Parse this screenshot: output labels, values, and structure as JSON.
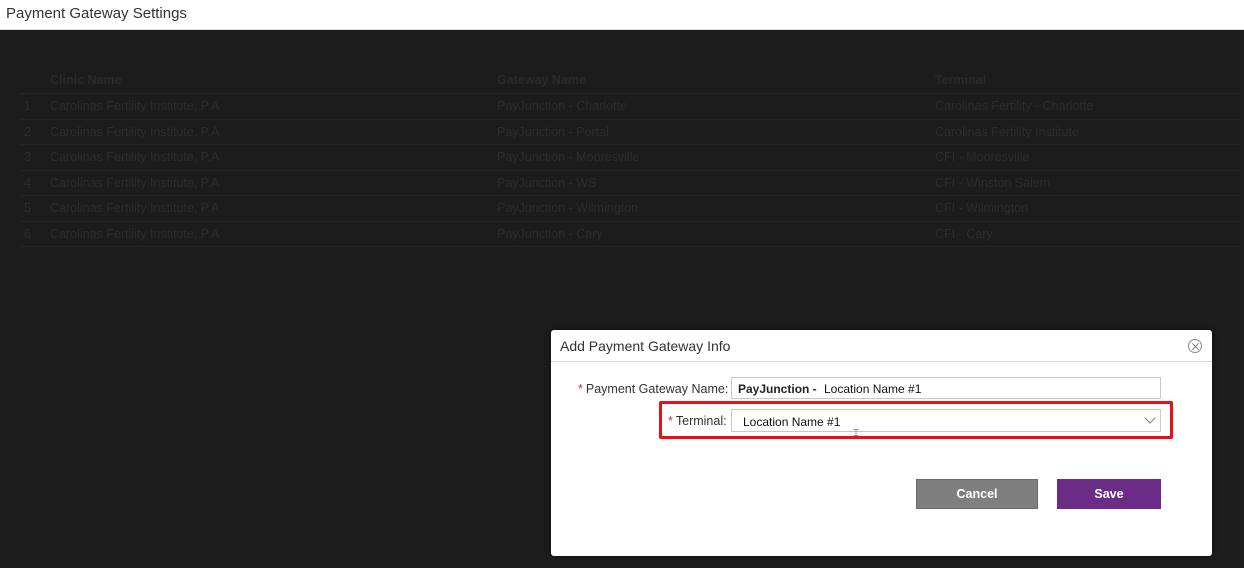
{
  "header": {
    "title": "Payment Gateway Settings"
  },
  "table": {
    "columns": [
      "Clinic Name",
      "Gateway Name",
      "Terminal"
    ],
    "rows": [
      {
        "index": "1",
        "clinic": "Carolinas Fertility Institute, P.A",
        "gateway": "PayJunction - Charlotte",
        "terminal": "Carolinas Fertility - Charlotte"
      },
      {
        "index": "2",
        "clinic": "Carolinas Fertility Institute, P.A",
        "gateway": "PayJunction - Portal",
        "terminal": "Carolinas Fertility Institute"
      },
      {
        "index": "3",
        "clinic": "Carolinas Fertility Institute, P.A",
        "gateway": "PayJunction - Mooresville",
        "terminal": "CFI - Mooresville"
      },
      {
        "index": "4",
        "clinic": "Carolinas Fertility Institute, P.A",
        "gateway": "PayJunction - WS",
        "terminal": "CFI - Winston Salem"
      },
      {
        "index": "5",
        "clinic": "Carolinas Fertility Institute, P.A",
        "gateway": "PayJunction - Wilmington",
        "terminal": "CFI - Wilmington"
      },
      {
        "index": "6",
        "clinic": "Carolinas Fertility Institute, P.A",
        "gateway": "PayJunction - Cary",
        "terminal": "CFI - Cary"
      }
    ]
  },
  "modal": {
    "title": "Add Payment Gateway Info",
    "gateway_label": "Payment Gateway Name:",
    "gateway_prefix": "PayJunction -",
    "gateway_value": "Location Name #1",
    "terminal_label": "Terminal:",
    "terminal_value": "Location Name #1",
    "required_mark": "*",
    "cancel_label": "Cancel",
    "save_label": "Save"
  },
  "colors": {
    "save_button": "#6a2c86",
    "cancel_button": "#7f7f7f",
    "highlight": "#e5121a"
  }
}
